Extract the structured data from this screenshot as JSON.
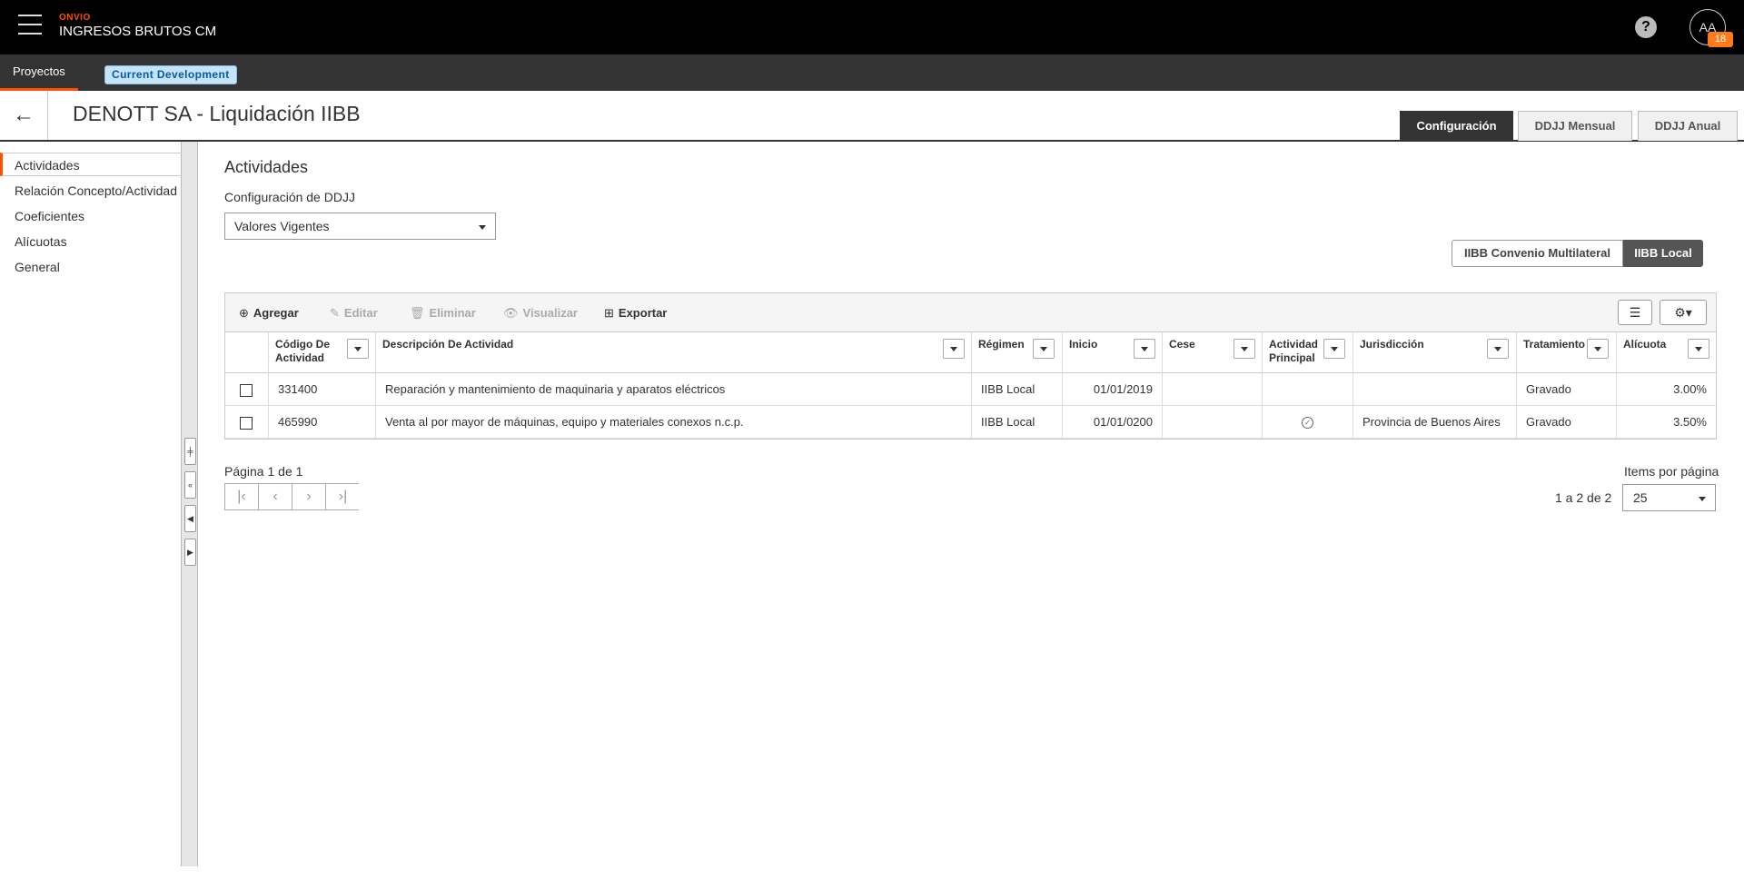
{
  "header": {
    "brand": "ONVIO",
    "app_title": "INGRESOS BRUTOS CM",
    "help": "?",
    "avatar": "AA",
    "notification_count": "18"
  },
  "subbar": {
    "tab": "Proyectos",
    "env_badge": "Current Development"
  },
  "page": {
    "title": "DENOTT SA - Liquidación IIBB",
    "tabs": [
      "Configuración",
      "DDJJ Mensual",
      "DDJJ Anual"
    ]
  },
  "sidebar": {
    "items": [
      "Actividades",
      "Relación Concepto/Actividad",
      "Coeficientes",
      "Alícuotas",
      "General"
    ]
  },
  "main": {
    "section_title": "Actividades",
    "config_label": "Configuración de DDJJ",
    "config_value": "Valores Vigentes",
    "segments": [
      "IIBB Convenio Multilateral",
      "IIBB Local"
    ]
  },
  "toolbar": {
    "add": "Agregar",
    "edit": "Editar",
    "delete": "Eliminar",
    "view": "Visualizar",
    "export": "Exportar"
  },
  "table": {
    "columns": [
      "Código De Actividad",
      "Descripción De Actividad",
      "Régimen",
      "Inicio",
      "Cese",
      "Actividad Principal",
      "Jurisdicción",
      "Tratamiento",
      "Alícuota"
    ],
    "rows": [
      [
        "331400",
        "Reparación y mantenimiento de maquinaria y aparatos eléctricos",
        "IIBB Local",
        "01/01/2019",
        "",
        "",
        "",
        "Gravado",
        "3.00%"
      ],
      [
        "465990",
        "Venta al por mayor de máquinas, equipo y materiales conexos n.c.p.",
        "IIBB Local",
        "01/01/0200",
        "",
        "✓",
        "Provincia de Buenos Aires",
        "Gravado",
        "3.50%"
      ]
    ]
  },
  "pager": {
    "label": "Página 1 de 1",
    "items_label": "Items por página",
    "range": "1 a 2 de 2",
    "page_size": "25"
  },
  "colors": {
    "accent": "#fe5000",
    "header_bg": "#000000",
    "subbar_bg": "#333333"
  }
}
